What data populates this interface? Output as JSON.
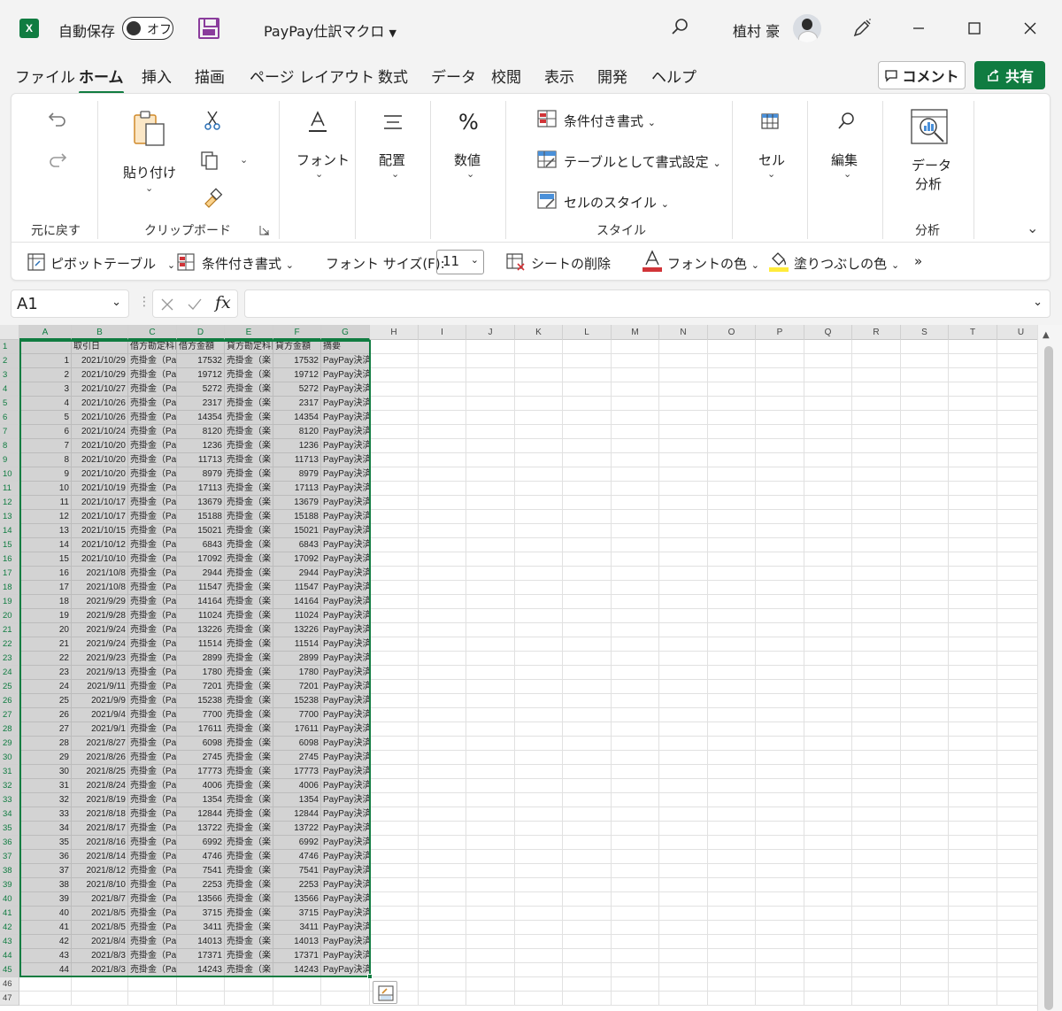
{
  "titlebar": {
    "app_icon_letter": "X",
    "autosave_label": "自動保存",
    "autosave_state": "オフ",
    "doc_title": "PayPay仕訳マクロ",
    "user_name": "植村 豪"
  },
  "menu": {
    "tabs": [
      "ファイル",
      "ホーム",
      "挿入",
      "描画",
      "ページ レイアウト",
      "数式",
      "データ",
      "校閲",
      "表示",
      "開発",
      "ヘルプ"
    ],
    "active": "ホーム",
    "comment_label": "コメント",
    "share_label": "共有"
  },
  "ribbon": {
    "undo_group": "元に戻す",
    "paste_label": "貼り付け",
    "clipboard_group": "クリップボード",
    "font_label": "フォント",
    "align_label": "配置",
    "number_label": "数値",
    "cond_format": "条件付き書式",
    "table_format": "テーブルとして書式設定",
    "cell_style": "セルのスタイル",
    "style_group": "スタイル",
    "cells_label": "セル",
    "edit_label": "編集",
    "data_analysis_line1": "データ",
    "data_analysis_line2": "分析",
    "analysis_group": "分析"
  },
  "quickbar": {
    "pivot": "ピボットテーブル",
    "cond_format": "条件付き書式",
    "font_size_label": "フォント サイズ(F):",
    "font_size_value": "11",
    "delete_sheet": "シートの削除",
    "font_color": "フォントの色",
    "fill_color": "塗りつぶしの色",
    "more": "»"
  },
  "formula": {
    "name_box": "A1",
    "fx": "fx",
    "content": ""
  },
  "sheet": {
    "columns": [
      "A",
      "B",
      "C",
      "D",
      "E",
      "F",
      "G",
      "H",
      "I",
      "J",
      "K",
      "L",
      "M",
      "N",
      "O",
      "P",
      "Q",
      "R",
      "S",
      "T",
      "U"
    ],
    "headers": [
      "",
      "取引日",
      "借方勘定科目",
      "借方金額",
      "貸方勘定科目",
      "貸方金額",
      "摘要"
    ],
    "debit_account": "売掛金（Pa",
    "credit_account": "売掛金（楽",
    "memo": "PayPay決済",
    "rows": [
      [
        1,
        "2021/10/29",
        17532
      ],
      [
        2,
        "2021/10/29",
        19712
      ],
      [
        3,
        "2021/10/27",
        5272
      ],
      [
        4,
        "2021/10/26",
        2317
      ],
      [
        5,
        "2021/10/26",
        14354
      ],
      [
        6,
        "2021/10/24",
        8120
      ],
      [
        7,
        "2021/10/20",
        1236
      ],
      [
        8,
        "2021/10/20",
        11713
      ],
      [
        9,
        "2021/10/20",
        8979
      ],
      [
        10,
        "2021/10/19",
        17113
      ],
      [
        11,
        "2021/10/17",
        13679
      ],
      [
        12,
        "2021/10/17",
        15188
      ],
      [
        13,
        "2021/10/15",
        15021
      ],
      [
        14,
        "2021/10/12",
        6843
      ],
      [
        15,
        "2021/10/10",
        17092
      ],
      [
        16,
        "2021/10/8",
        2944
      ],
      [
        17,
        "2021/10/8",
        11547
      ],
      [
        18,
        "2021/9/29",
        14164
      ],
      [
        19,
        "2021/9/28",
        11024
      ],
      [
        20,
        "2021/9/24",
        13226
      ],
      [
        21,
        "2021/9/24",
        11514
      ],
      [
        22,
        "2021/9/23",
        2899
      ],
      [
        23,
        "2021/9/13",
        1780
      ],
      [
        24,
        "2021/9/11",
        7201
      ],
      [
        25,
        "2021/9/9",
        15238
      ],
      [
        26,
        "2021/9/4",
        7700
      ],
      [
        27,
        "2021/9/1",
        17611
      ],
      [
        28,
        "2021/8/27",
        6098
      ],
      [
        29,
        "2021/8/26",
        2745
      ],
      [
        30,
        "2021/8/25",
        17773
      ],
      [
        31,
        "2021/8/24",
        4006
      ],
      [
        32,
        "2021/8/19",
        1354
      ],
      [
        33,
        "2021/8/18",
        12844
      ],
      [
        34,
        "2021/8/17",
        13722
      ],
      [
        35,
        "2021/8/16",
        6992
      ],
      [
        36,
        "2021/8/14",
        4746
      ],
      [
        37,
        "2021/8/12",
        7541
      ],
      [
        38,
        "2021/8/10",
        2253
      ],
      [
        39,
        "2021/8/7",
        13566
      ],
      [
        40,
        "2021/8/5",
        3715
      ],
      [
        41,
        "2021/8/5",
        3411
      ],
      [
        42,
        "2021/8/4",
        14013
      ],
      [
        43,
        "2021/8/3",
        17371
      ],
      [
        44,
        "2021/8/3",
        14243
      ]
    ],
    "total_rows_visible": 47
  },
  "colors": {
    "accent": "#107c41",
    "save_icon": "#8a3c9c",
    "font_color_bar": "#d13438",
    "fill_color_bar": "#ffeb3b"
  }
}
